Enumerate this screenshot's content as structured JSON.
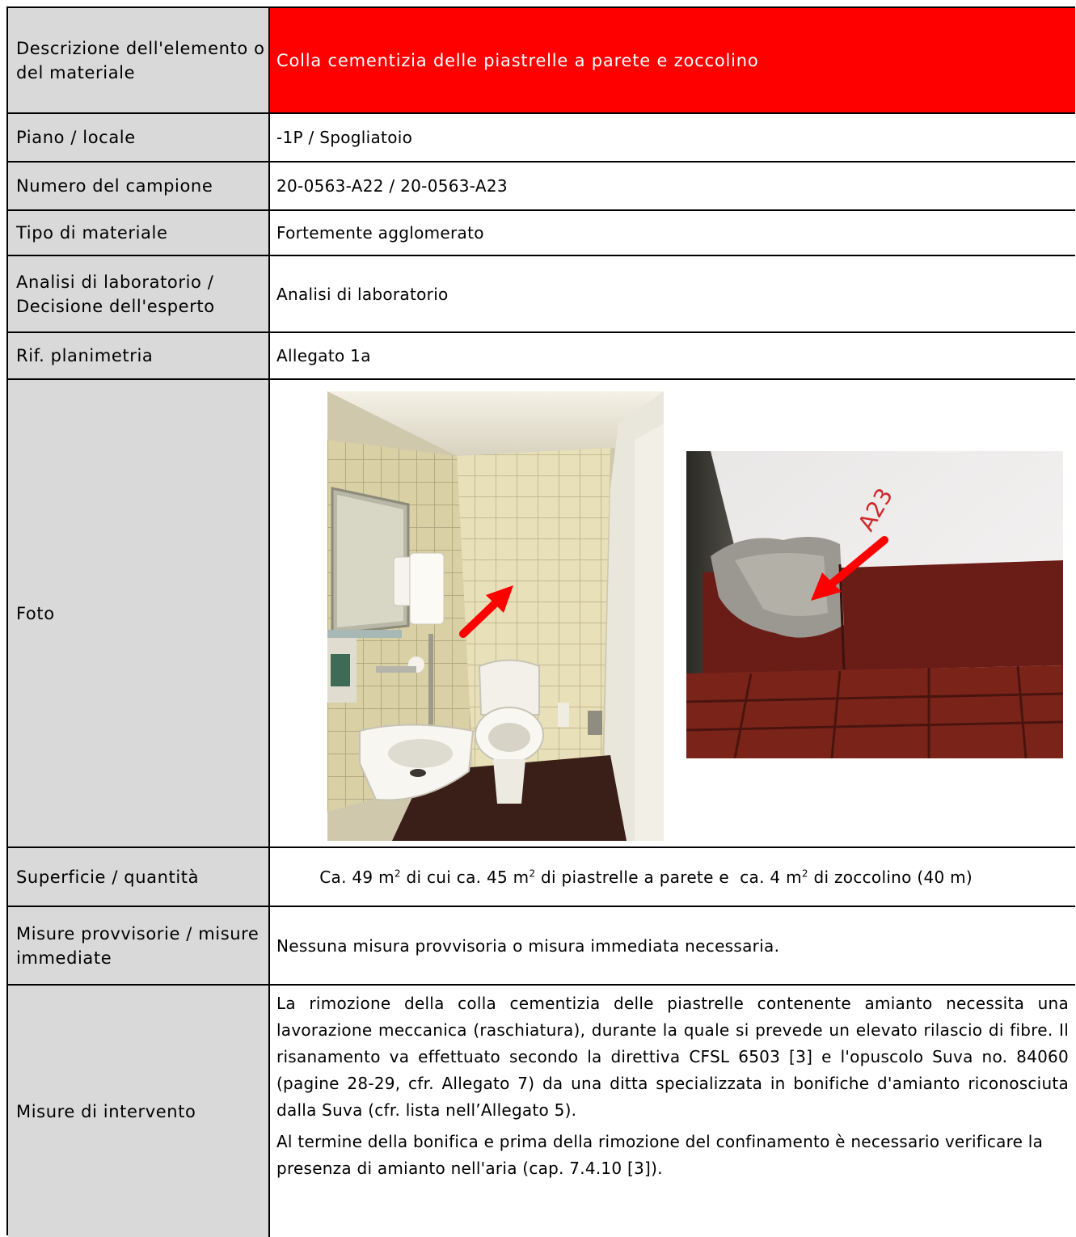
{
  "rows": {
    "descrizione": {
      "label": "Descrizione dell'elemento o del materiale",
      "value": "Colla cementizia delle piastrelle a parete e zoccolino",
      "highlight_color": "#ff0000"
    },
    "piano": {
      "label": "Piano / locale",
      "value": "-1P / Spogliatoio"
    },
    "campione": {
      "label": "Numero del campione",
      "value": "20-0563-A22 / 20-0563-A23"
    },
    "tipo": {
      "label": "Tipo di materiale",
      "value": "Fortemente agglomerato"
    },
    "analisi": {
      "label": "Analisi di laboratorio / Decisione dell'esperto",
      "value": "Analisi di laboratorio"
    },
    "rif": {
      "label": "Rif. planimetria",
      "value": "Allegato 1a"
    },
    "foto": {
      "label": "Foto",
      "photo_1": {
        "subject": "bagno con piastrelle a parete, lavandino e WC",
        "arrow_color": "#ff0000"
      },
      "photo_2": {
        "subject": "prelievo campione su zoccolino",
        "sample_mark": "A23",
        "arrow_color": "#ff0000"
      }
    },
    "superficie": {
      "label": "Superficie / quantità",
      "p1": "Ca. 49 m",
      "p2": " di cui ca. 45 m",
      "p3": " di piastrelle a parete e  ca. 4 m",
      "p4": " di zoccolino (40 m)",
      "sup": "2"
    },
    "provvisorie": {
      "label": "Misure provvisorie / misure immediate",
      "value": "Nessuna misura provvisoria o misura immediata necessaria."
    },
    "intervento": {
      "label": "Misure di intervento",
      "para1": "La rimozione della colla cementizia delle piastrelle contenente amianto necessita una lavorazione meccanica (raschiatura), durante la quale si prevede un elevato rilascio di fibre. Il risanamento va effettuato secondo la direttiva CFSL 6503 [3] e l'opuscolo Suva no. 84060 (pagine 28-29, cfr. Allegato 7) da una ditta specializzata in bonifiche d'amianto riconosciuta dalla Suva (cfr. lista nell’Allegato 5).",
      "para2": "Al termine della bonifica e prima della rimozione del confinamento è necessario verificare la presenza di amianto nell'aria (cap. 7.4.10 [3])."
    }
  }
}
